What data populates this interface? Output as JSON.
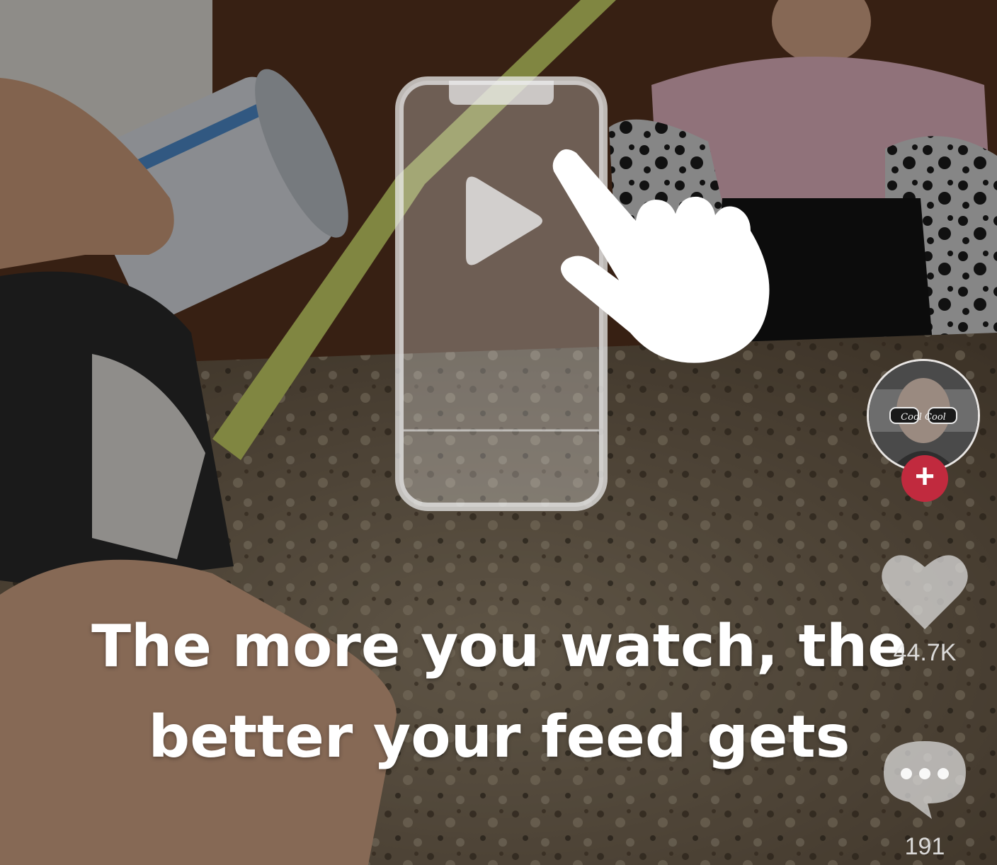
{
  "overlay": {
    "message_line1": "The more you watch, the",
    "message_line2": "better your feed gets"
  },
  "side_rail": {
    "avatar_icon": "creator-avatar",
    "avatar_caption": "Cool Cool",
    "follow_label": "+",
    "like_icon": "heart-icon",
    "like_count": "44.7K",
    "comment_icon": "comment-bubble-icon",
    "comment_count": "191"
  },
  "tutorial": {
    "phone_icon": "phone-outline-icon",
    "play_icon": "play-icon",
    "hand_icon": "pointing-hand-icon"
  },
  "colors": {
    "follow_button": "#c12a3e",
    "overlay_text": "#ffffff"
  }
}
